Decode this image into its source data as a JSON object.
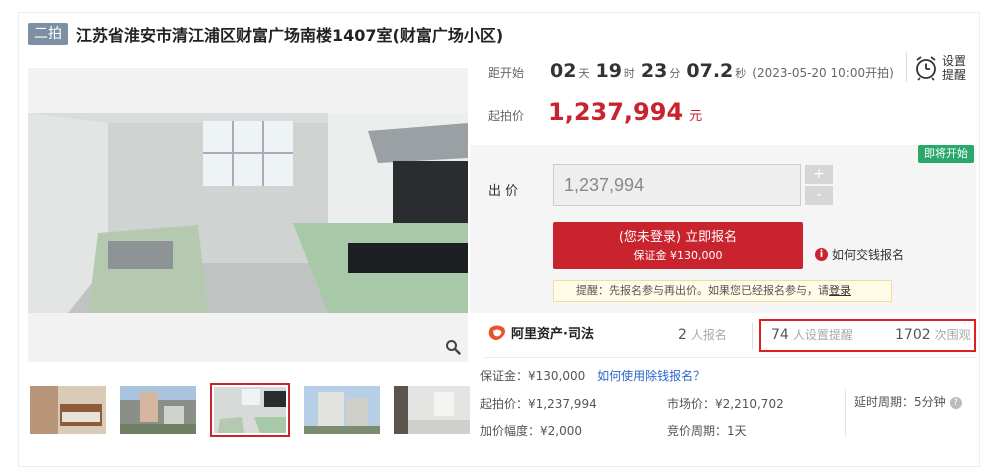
{
  "title": {
    "badge": "二拍",
    "text": "江苏省淮安市清江浦区财富广场南楼1407室(财富广场小区)"
  },
  "countdown": {
    "label": "距开始",
    "days": "02",
    "days_unit": "天",
    "hours": "19",
    "hours_unit": "时",
    "minutes": "23",
    "minutes_unit": "分",
    "seconds": "07.2",
    "seconds_unit": "秒",
    "start_note": "(2023-05-20 10:00开拍)"
  },
  "reminder": {
    "label": "设置提醒",
    "icon": "alarm-clock-icon"
  },
  "start_price": {
    "label": "起拍价",
    "value": "1,237,994",
    "unit": "元"
  },
  "bid": {
    "status_tag": "即将开始",
    "label": "出 价",
    "value": "1,237,994",
    "plus": "+",
    "minus": "-",
    "signup_main": "(您未登录) 立即报名",
    "signup_sub": "保证金 ¥130,000",
    "how_to_pay": "如何交钱报名",
    "tip_text": "提醒：先报名参与再出价。如果您已经报名参与，请",
    "tip_link": "登录"
  },
  "stats": {
    "brand": "阿里资产·司法",
    "signups_count": "2",
    "signups_unit": "人报名",
    "reminders_count": "74",
    "reminders_unit": "人设置提醒",
    "views_count": "1702",
    "views_unit": "次围观"
  },
  "details": {
    "deposit": "保证金：¥130,000",
    "deposit_link": "如何使用除钱报名？",
    "start_price": "起拍价：¥1,237,994",
    "market_price": "市场价：¥2,210,702",
    "delay_period": "延时周期：5分钟",
    "increment": "加价幅度：¥2,000",
    "bid_period": "竞价周期：1天"
  },
  "colors": {
    "accent_red": "#c9242e",
    "tag_green": "#2aa86b",
    "link_blue": "#2a66c9",
    "badge_gray": "#7d8fa3"
  }
}
